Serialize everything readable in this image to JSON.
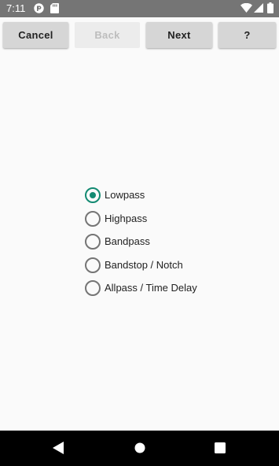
{
  "status_bar": {
    "time": "7:11",
    "left_icons": [
      "pocketcasts-icon",
      "sd-card-icon"
    ],
    "right_icons": [
      "wifi-icon",
      "signal-icon",
      "battery-icon"
    ]
  },
  "toolbar": {
    "cancel_label": "Cancel",
    "back_label": "Back",
    "next_label": "Next",
    "help_label": "?"
  },
  "filter_types": {
    "selected_index": 0,
    "accent_color": "#138a72",
    "options": [
      {
        "label": "Lowpass"
      },
      {
        "label": "Highpass"
      },
      {
        "label": "Bandpass"
      },
      {
        "label": "Bandstop / Notch"
      },
      {
        "label": "Allpass / Time Delay"
      }
    ]
  },
  "nav_bar": {
    "icons": [
      "back-triangle-icon",
      "home-circle-icon",
      "recents-square-icon"
    ]
  }
}
